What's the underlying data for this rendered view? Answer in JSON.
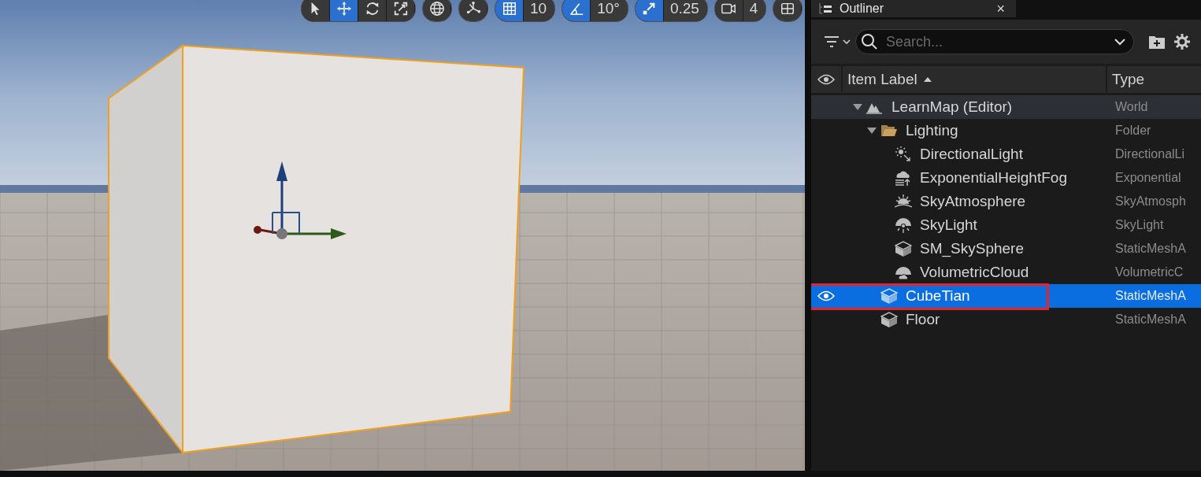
{
  "viewport_toolbar": [
    {
      "buttons": [
        {
          "kind": "select",
          "selected": false
        },
        {
          "kind": "move",
          "selected": true
        },
        {
          "kind": "rotate",
          "selected": false
        },
        {
          "kind": "scale",
          "selected": false
        }
      ]
    },
    {
      "buttons": [
        {
          "kind": "globe",
          "selected": false
        }
      ]
    },
    {
      "buttons": [
        {
          "kind": "surface-snap",
          "selected": false
        }
      ]
    },
    {
      "buttons": [
        {
          "kind": "grid",
          "selected": true
        }
      ],
      "value": "10"
    },
    {
      "buttons": [
        {
          "kind": "angle",
          "selected": true
        }
      ],
      "value": "10°"
    },
    {
      "buttons": [
        {
          "kind": "scale-snap",
          "selected": true
        }
      ],
      "value": "0.25"
    },
    {
      "buttons": [
        {
          "kind": "camera",
          "selected": false
        }
      ],
      "value": "4"
    },
    {
      "buttons": [
        {
          "kind": "layout",
          "selected": false
        }
      ]
    }
  ],
  "outliner": {
    "tab": {
      "title": "Outliner",
      "close": "×"
    },
    "search": {
      "placeholder": "Search..."
    },
    "columns": [
      {
        "label": "Item Label",
        "sorted": true
      },
      {
        "label": "Type",
        "sorted": false
      }
    ],
    "items": [
      {
        "label": "LearnMap (Editor)",
        "type": "World",
        "kind": "world",
        "expanded": true,
        "selected": false,
        "highlighted": false,
        "children": [
          {
            "label": "Lighting",
            "type": "Folder",
            "kind": "folder",
            "expanded": true,
            "selected": false,
            "highlighted": false,
            "children": [
              {
                "label": "DirectionalLight",
                "type": "DirectionalLi",
                "kind": "light",
                "selected": false,
                "highlighted": false
              },
              {
                "label": "ExponentialHeightFog",
                "type": "Exponential",
                "kind": "fog",
                "selected": false,
                "highlighted": false
              },
              {
                "label": "SkyAtmosphere",
                "type": "SkyAtmosph",
                "kind": "atmosphere",
                "selected": false,
                "highlighted": false
              },
              {
                "label": "SkyLight",
                "type": "SkyLight",
                "kind": "skylight",
                "selected": false,
                "highlighted": false
              },
              {
                "label": "SM_SkySphere",
                "type": "StaticMeshA",
                "kind": "mesh",
                "selected": false,
                "highlighted": false
              },
              {
                "label": "VolumetricCloud",
                "type": "VolumetricC",
                "kind": "cloud",
                "selected": false,
                "highlighted": false
              }
            ]
          },
          {
            "label": "CubeTian",
            "type": "StaticMeshA",
            "kind": "mesh",
            "selected": true,
            "highlighted": true
          },
          {
            "label": "Floor",
            "type": "StaticMeshA",
            "kind": "mesh",
            "selected": false,
            "highlighted": false
          }
        ]
      }
    ]
  }
}
